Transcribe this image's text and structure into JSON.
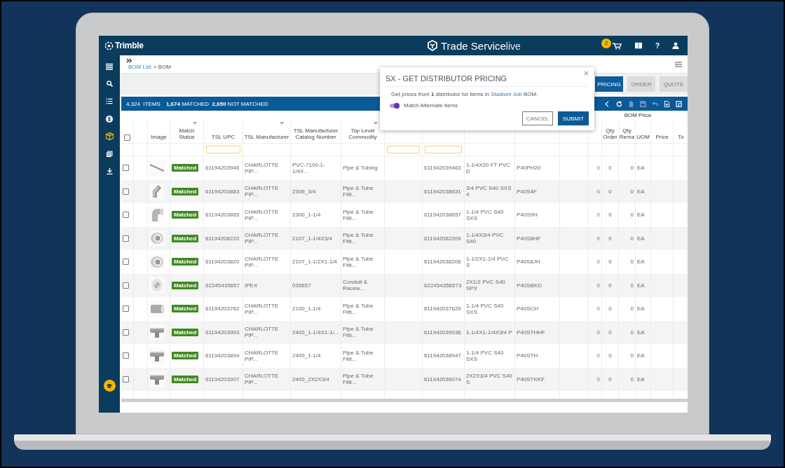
{
  "header": {
    "logo": "Trimble",
    "title": "Trade Service",
    "title_suffix": "live",
    "cart_badge": "2",
    "help": "?"
  },
  "sidebar": {
    "items": [
      {
        "kind": "menu",
        "selected": false
      },
      {
        "kind": "search",
        "selected": false
      },
      {
        "kind": "list",
        "selected": false
      },
      {
        "kind": "dollar",
        "selected": false
      },
      {
        "kind": "box",
        "selected": true
      },
      {
        "kind": "document",
        "selected": false
      },
      {
        "kind": "download",
        "selected": false
      }
    ]
  },
  "breadcrumb": {
    "link": "BOM List",
    "current": "> BOM"
  },
  "actions": [
    {
      "label": "PRICING",
      "disabled": false
    },
    {
      "label": "ORDER",
      "disabled": true
    },
    {
      "label": "QUOTE",
      "disabled": true
    }
  ],
  "summary": {
    "items": "4,324  ITEMS",
    "counts": "**1,674** MATCHED  **2,650** NOT MATCHED"
  },
  "toolbar": [
    {
      "kind": "back",
      "disabled": false
    },
    {
      "kind": "refresh",
      "disabled": false
    },
    {
      "kind": "trash",
      "disabled": true
    },
    {
      "kind": "save",
      "disabled": true
    },
    {
      "kind": "undo",
      "disabled": true
    },
    {
      "kind": "export",
      "disabled": false
    },
    {
      "kind": "copy",
      "disabled": false
    }
  ],
  "table": {
    "group_header": "BOM Price",
    "select_all": false,
    "columns": [
      {
        "menu": false,
        "filter": false
      },
      {
        "menu": false,
        "filter": false
      },
      {
        "label": "Image",
        "menu": false,
        "filter": false
      },
      {
        "label": "Match Status",
        "menu": true,
        "filter": false
      },
      {
        "label": "TSL UPC",
        "menu": false,
        "filter": true
      },
      {
        "label": "TSL Manufacturer",
        "menu": true,
        "filter": false
      },
      {
        "label": "TSL Manufacturer Catalog Number",
        "menu": false,
        "filter": false
      },
      {
        "label": "Top Level Commodity",
        "menu": true,
        "filter": false
      },
      {
        "menu": false,
        "filter": true
      },
      {
        "menu": false,
        "filter": true
      },
      {
        "menu": false,
        "filter": false
      },
      {
        "menu": false,
        "filter": false
      },
      {
        "menu": false,
        "filter": false
      },
      {
        "menu": false,
        "filter": false
      },
      {
        "label": "Qty Order",
        "menu": false,
        "filter": false
      },
      {
        "label": "Qty Rema",
        "menu": false,
        "filter": false
      },
      {
        "label": "UOM",
        "menu": false,
        "filter": false
      },
      {
        "label": "Price",
        "menu": false,
        "filter": false
      },
      {
        "label": "To",
        "menu": false,
        "filter": false
      }
    ],
    "rows": [
      {
        "checked": false,
        "status": "Matched",
        "upc": "61194203946",
        "manufacturer": "CHARLOTTE PIP...",
        "catalog": "PVC-7100-1-1/4X...",
        "commodity": "Pipe & Tubing",
        "column_10": "611942039463",
        "column_11": "1-1/4X20 FT PVC D",
        "column_12": "P40PH20",
        "column_14": "0",
        "qty_order": "0",
        "qty_remaining": "0",
        "uom": "EA"
      },
      {
        "checked": false,
        "status": "Matched",
        "upc": "61194203883",
        "manufacturer": "CHARLOTTE PIP...",
        "catalog": "2309_3/4",
        "commodity": "Pipe & Tube Fitti...",
        "column_10": "611942038831",
        "column_11": "3/4 PVC S40 SXS 4",
        "column_12": "P40S4F",
        "column_14": "0",
        "qty_order": "0",
        "qty_remaining": "0",
        "uom": "EA"
      },
      {
        "checked": false,
        "status": "Matched",
        "upc": "61194203865",
        "manufacturer": "CHARLOTTE PIP...",
        "catalog": "2300_1-1/4",
        "commodity": "Pipe & Tube Fitti...",
        "column_10": "611942038657",
        "column_11": "1-1/4 PVC S40 SXS",
        "column_12": "P40S9H",
        "column_14": "0",
        "qty_order": "0",
        "qty_remaining": "0",
        "uom": "EA"
      },
      {
        "checked": false,
        "status": "Matched",
        "upc": "61194208220",
        "manufacturer": "CHARLOTTE PIP...",
        "catalog": "2107_1-1/4X3/4",
        "commodity": "Pipe & Tube Fitti...",
        "column_10": "611942082209",
        "column_11": "1-1/4X3/4 PVC S40",
        "column_12": "P40S8HF",
        "column_14": "0",
        "qty_order": "0",
        "qty_remaining": "0",
        "uom": "EA"
      },
      {
        "checked": false,
        "status": "Matched",
        "upc": "61194203820",
        "manufacturer": "CHARLOTTE PIP...",
        "catalog": "2107_1-1/2X1-1/4",
        "commodity": "Pipe & Tube Fitti...",
        "column_10": "611942038206",
        "column_11": "1-1/2X1-1/4 PVC S",
        "column_12": "P40S8JH",
        "column_14": "0",
        "qty_order": "0",
        "qty_remaining": "0",
        "uom": "EA"
      },
      {
        "checked": false,
        "status": "Matched",
        "upc": "62245435657",
        "manufacturer": "IPEX",
        "catalog": "035657",
        "commodity": "Conduit & Racew...",
        "column_10": "622454356573",
        "column_11": "2X1/2 PVC S40 SPX",
        "column_12": "P40SBKD",
        "column_14": "0",
        "qty_order": "0",
        "qty_remaining": "0",
        "uom": "EA"
      },
      {
        "checked": false,
        "status": "Matched",
        "upc": "61194203762",
        "manufacturer": "CHARLOTTE PIP...",
        "catalog": "2100_1-1/4",
        "commodity": "Pipe & Tube Fitti...",
        "column_10": "611942037629",
        "column_11": "1-1/4 PVC S40 SXS",
        "column_12": "P40SCH",
        "column_14": "0",
        "qty_order": "0",
        "qty_remaining": "0",
        "uom": "EA"
      },
      {
        "checked": false,
        "status": "Matched",
        "upc": "61194203903",
        "manufacturer": "CHARLOTTE PIP...",
        "catalog": "2400_1-1/4X1-1/...",
        "commodity": "Pipe & Tube Fitti...",
        "column_10": "611942039036",
        "column_11": "1-1/4X1-1/4X3/4 P",
        "column_12": "P40STHHF",
        "column_14": "0",
        "qty_order": "0",
        "qty_remaining": "0",
        "uom": "EA"
      },
      {
        "checked": false,
        "status": "Matched",
        "upc": "61194203894",
        "manufacturer": "CHARLOTTE PIP...",
        "catalog": "2400_1-1/4",
        "commodity": "Pipe & Tube Fitti...",
        "column_10": "611942038947",
        "column_11": "1-1/4 PVC S40 SXS",
        "column_12": "P40STH",
        "column_14": "0",
        "qty_order": "0",
        "qty_remaining": "0",
        "uom": "EA"
      },
      {
        "checked": false,
        "status": "Matched",
        "upc": "61194203907",
        "manufacturer": "CHARLOTTE PIP...",
        "catalog": "2400_2X2X3/4",
        "commodity": "Pipe & Tube Fitti...",
        "column_10": "611942039074",
        "column_11": "2X2X3/4 PVC S40 S",
        "column_12": "P40STKKF",
        "column_14": "0",
        "qty_order": "0",
        "qty_remaining": "0",
        "uom": "EA"
      }
    ]
  },
  "modal": {
    "title": "SX - GET DISTRIBUTOR PRICING",
    "message_before": "Get prices from **1** distributor for items in ",
    "link": "Stadium Job",
    "message_after": " BOM.",
    "toggle": {
      "label": "Match Alternate Items",
      "on": true
    },
    "cancel": "CANCEL",
    "submit": "SUBMIT"
  }
}
